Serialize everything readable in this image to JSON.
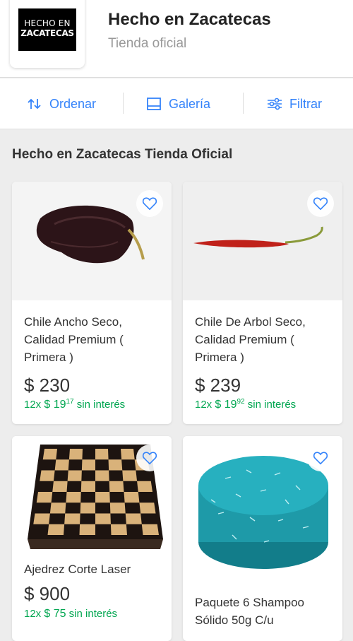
{
  "store": {
    "logo_line1": "HECHO EN",
    "logo_line2": "ZACATECAS",
    "name": "Hecho en Zacatecas",
    "subtitle": "Tienda oficial"
  },
  "toolbar": {
    "sort_label": "Ordenar",
    "gallery_label": "Galería",
    "filter_label": "Filtrar"
  },
  "section_title": "Hecho en Zacatecas Tienda Oficial",
  "colors": {
    "accent": "#3483fa",
    "installment": "#00a650"
  },
  "products": [
    {
      "title": "Chile Ancho Seco, Calidad Premium ( Primera )",
      "price": "$ 230",
      "inst_count": "12x",
      "inst_whole": "$ 19",
      "inst_cents": "17",
      "inst_suffix": "sin interés",
      "image": "dried-ancho-chile"
    },
    {
      "title": "Chile De Arbol Seco, Calidad Premium ( Primera )",
      "price": "$ 239",
      "inst_count": "12x",
      "inst_whole": "$ 19",
      "inst_cents": "92",
      "inst_suffix": "sin interés",
      "image": "red-arbol-chile"
    },
    {
      "title": "Ajedrez Corte Laser",
      "price": "$ 900",
      "inst_count": "12x",
      "inst_whole": "$ 75",
      "inst_cents": "",
      "inst_suffix": "sin interés",
      "image": "wooden-chessboard"
    },
    {
      "title": "Paquete 6 Shampoo Sólido 50g C/u",
      "price": "",
      "inst_count": "",
      "inst_whole": "",
      "inst_cents": "",
      "inst_suffix": "",
      "image": "blue-shampoo-bar"
    }
  ],
  "icons": [
    "sort-icon",
    "gallery-icon",
    "filter-icon",
    "heart-icon"
  ]
}
